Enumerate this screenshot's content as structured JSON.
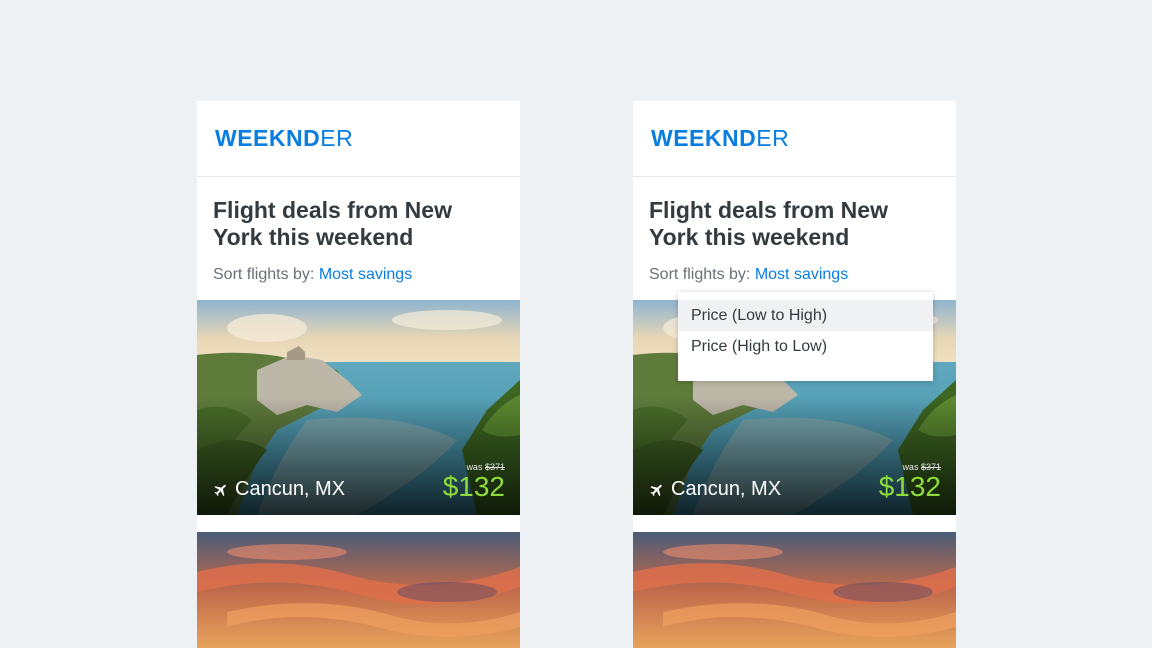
{
  "brand": {
    "logo_bold": "WEEKND",
    "logo_light": "ER"
  },
  "heading": "Flight deals from New York this weekend",
  "sort": {
    "label": "Sort flights by:",
    "value": "Most savings"
  },
  "deal": {
    "icon": "plane-icon",
    "destination": "Cancun, MX",
    "was_label": "was",
    "was_price": "$371",
    "price": "$132"
  },
  "dropdown": {
    "options": [
      "Price (Low to High)",
      "Price (High to Low)"
    ],
    "highlighted_index": 0
  },
  "colors": {
    "accent": "#0a7ee0",
    "price": "#8edc3c",
    "background": "#edf1f4"
  }
}
